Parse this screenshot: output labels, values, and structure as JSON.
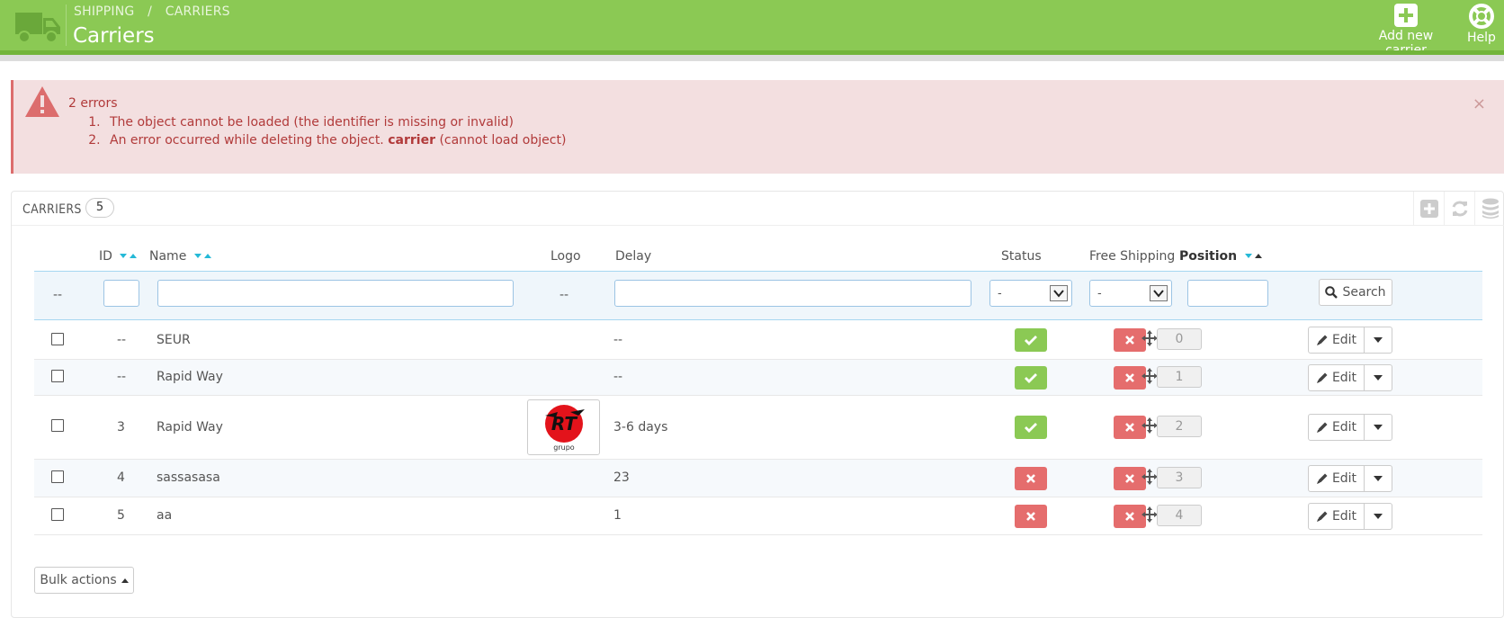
{
  "header": {
    "breadcrumb": [
      "SHIPPING",
      "/",
      "CARRIERS"
    ],
    "title": "Carriers",
    "add_label": "Add new carrier",
    "help_label": "Help",
    "bg_color": "#8bc954"
  },
  "alert": {
    "title": "2 errors",
    "items": [
      "The object cannot be loaded (the identifier is missing or invalid)",
      "An error occurred while deleting the object."
    ],
    "item2_strong": "carrier",
    "item2_suffix": "(cannot load object)",
    "close": "×"
  },
  "panel": {
    "title": "CARRIERS",
    "count": "5"
  },
  "table": {
    "headers": {
      "id": "ID",
      "name": "Name",
      "logo": "Logo",
      "delay": "Delay",
      "status": "Status",
      "free_shipping": "Free Shipping",
      "position": "Position"
    },
    "filters": {
      "bulk_placeholder": "--",
      "logo_placeholder": "--",
      "status_value": "-",
      "free_shipping_value": "-",
      "search_label": "Search"
    },
    "rows": [
      {
        "id": "--",
        "name": "SEUR",
        "delay": "--",
        "status": "enabled",
        "free_shipping": "disabled",
        "position": "0",
        "logo": ""
      },
      {
        "id": "--",
        "name": "Rapid Way",
        "delay": "--",
        "status": "enabled",
        "free_shipping": "disabled",
        "position": "1",
        "logo": ""
      },
      {
        "id": "3",
        "name": "Rapid Way",
        "delay": "3-6 days",
        "status": "enabled",
        "free_shipping": "disabled",
        "position": "2",
        "logo": "RT grupo"
      },
      {
        "id": "4",
        "name": "sassasasa",
        "delay": "23",
        "status": "disabled",
        "free_shipping": "disabled",
        "position": "3",
        "logo": ""
      },
      {
        "id": "5",
        "name": "aa",
        "delay": "1",
        "status": "disabled",
        "free_shipping": "disabled",
        "position": "4",
        "logo": ""
      }
    ],
    "edit_label": "Edit"
  },
  "bulk": {
    "label": "Bulk actions"
  },
  "colors": {
    "ok": "#8bc954",
    "error": "#e56d6d",
    "sort": "#25b9d7"
  }
}
